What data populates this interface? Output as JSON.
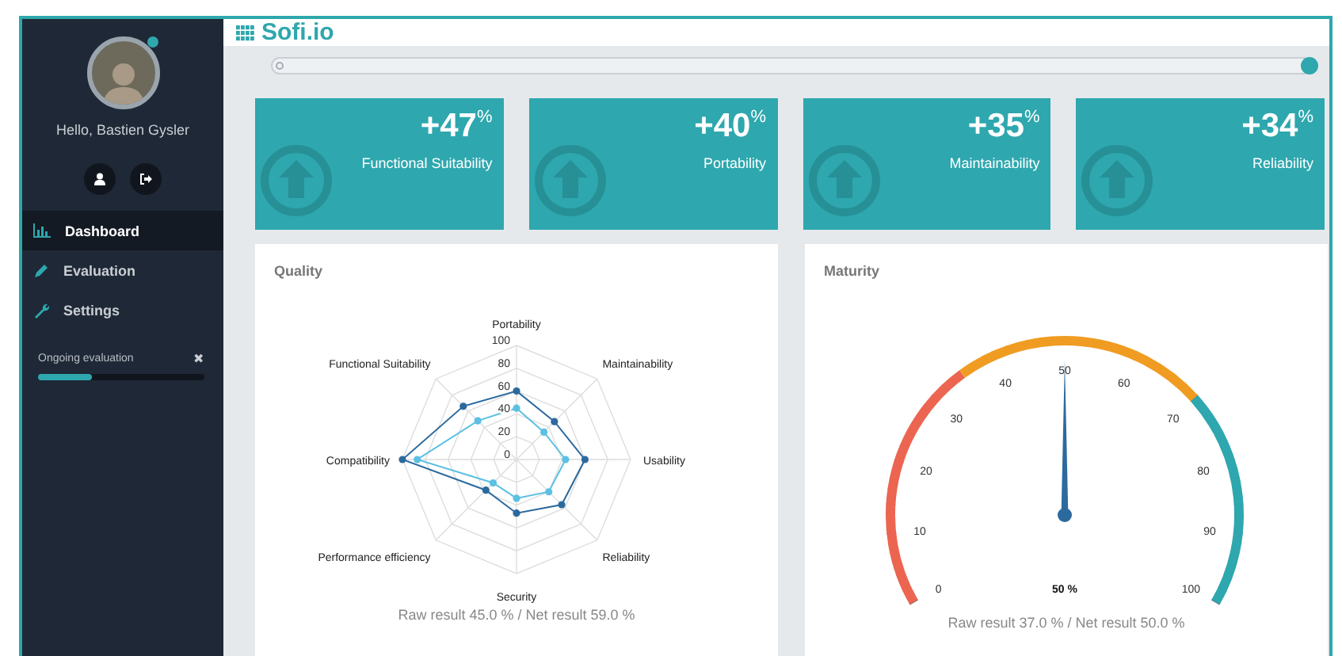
{
  "sidebar": {
    "greeting": "Hello, Bastien Gysler",
    "online": true,
    "nav": [
      {
        "label": "Dashboard",
        "kind": "chart",
        "selected": true
      },
      {
        "label": "Evaluation",
        "kind": "pencil",
        "selected": false
      },
      {
        "label": "Settings",
        "kind": "wrench",
        "selected": false
      }
    ],
    "evaluation": {
      "label": "Ongoing evaluation",
      "close": "✖",
      "level": 0.32
    }
  },
  "header": {
    "brand": "Sofi.io"
  },
  "slider": {
    "level": 1.0
  },
  "cards": [
    {
      "value": "+47",
      "unit": "%",
      "label": "Functional Suitability"
    },
    {
      "value": "+40",
      "unit": "%",
      "label": "Portability"
    },
    {
      "value": "+35",
      "unit": "%",
      "label": "Maintainability"
    },
    {
      "value": "+34",
      "unit": "%",
      "label": "Reliability"
    }
  ],
  "quality": {
    "title": "Quality",
    "footer": "Raw result 45.0 % / Net result 59.0 %",
    "chart_data": {
      "type": "radar",
      "categories": [
        "Portability",
        "Maintainability",
        "Usability",
        "Reliability",
        "Security",
        "Performance efficiency",
        "Compatibility",
        "Functional Suitability"
      ],
      "yticks": [
        0,
        20,
        40,
        60,
        80,
        100
      ],
      "ylim": [
        0,
        100
      ],
      "series": [
        {
          "color": "#2c6a9e",
          "values": [
            60,
            47,
            60,
            56,
            47,
            38,
            100,
            66
          ]
        },
        {
          "color": "#5bc0e2",
          "values": [
            45,
            34,
            43,
            40,
            34,
            29,
            87,
            48
          ]
        }
      ]
    }
  },
  "maturity": {
    "title": "Maturity",
    "footer": "Raw result 37.0 % / Net result 50.0 %",
    "value_label": "50 %",
    "level": 0.5,
    "ticks": [
      "0",
      "10",
      "20",
      "30",
      "40",
      "50",
      "60",
      "70",
      "80",
      "90",
      "100"
    ]
  }
}
